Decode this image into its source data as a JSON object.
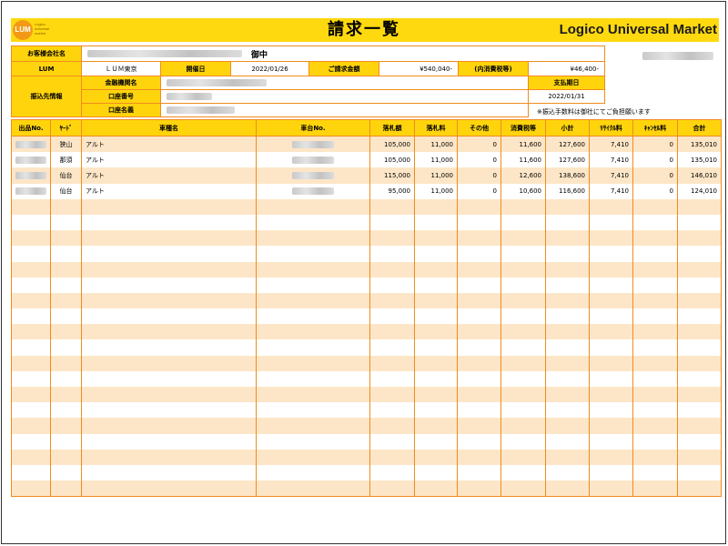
{
  "header": {
    "title": "請求一覧",
    "brand": "Logico Universal Market",
    "logo_text": "LUM",
    "logo_small": "Logico\nuniversal\nmarket"
  },
  "info": {
    "customer_label": "お客様会社名",
    "customer_suffix": "御中",
    "lum_label": "LUM",
    "lum_value": "ＬＵＭ東京",
    "date_label": "開催日",
    "date_value": "2022/01/26",
    "amount_label": "ご請求金額",
    "amount_value": "¥540,040-",
    "tax_label": "(内消費税等)",
    "tax_value": "¥46,400-",
    "transfer_label": "振込先情報",
    "bank_label": "金融機関名",
    "account_no_label": "口座番号",
    "account_name_label": "口座名義",
    "due_label": "支払期日",
    "due_value": "2022/01/31",
    "note": "※振込手数料は御社にてご負担願います"
  },
  "table": {
    "columns": [
      "出品No.",
      "ﾔｰﾄﾞ",
      "車種名",
      "車台No.",
      "落札額",
      "落札料",
      "その他",
      "消費税等",
      "小計",
      "ﾘｻｲｸﾙ料",
      "ｷｬﾝｾﾙ料",
      "合計"
    ],
    "rows": [
      {
        "yard": "狭山",
        "model": "アルト",
        "price": "105,000",
        "fee": "11,000",
        "other": "0",
        "tax": "11,600",
        "subtotal": "127,600",
        "recycle": "7,410",
        "cancel": "0",
        "total": "135,010"
      },
      {
        "yard": "那須",
        "model": "アルト",
        "price": "105,000",
        "fee": "11,000",
        "other": "0",
        "tax": "11,600",
        "subtotal": "127,600",
        "recycle": "7,410",
        "cancel": "0",
        "total": "135,010"
      },
      {
        "yard": "仙台",
        "model": "アルト",
        "price": "115,000",
        "fee": "11,000",
        "other": "0",
        "tax": "12,600",
        "subtotal": "138,600",
        "recycle": "7,410",
        "cancel": "0",
        "total": "146,010"
      },
      {
        "yard": "仙台",
        "model": "アルト",
        "price": "95,000",
        "fee": "11,000",
        "other": "0",
        "tax": "10,600",
        "subtotal": "116,600",
        "recycle": "7,410",
        "cancel": "0",
        "total": "124,010"
      }
    ]
  }
}
